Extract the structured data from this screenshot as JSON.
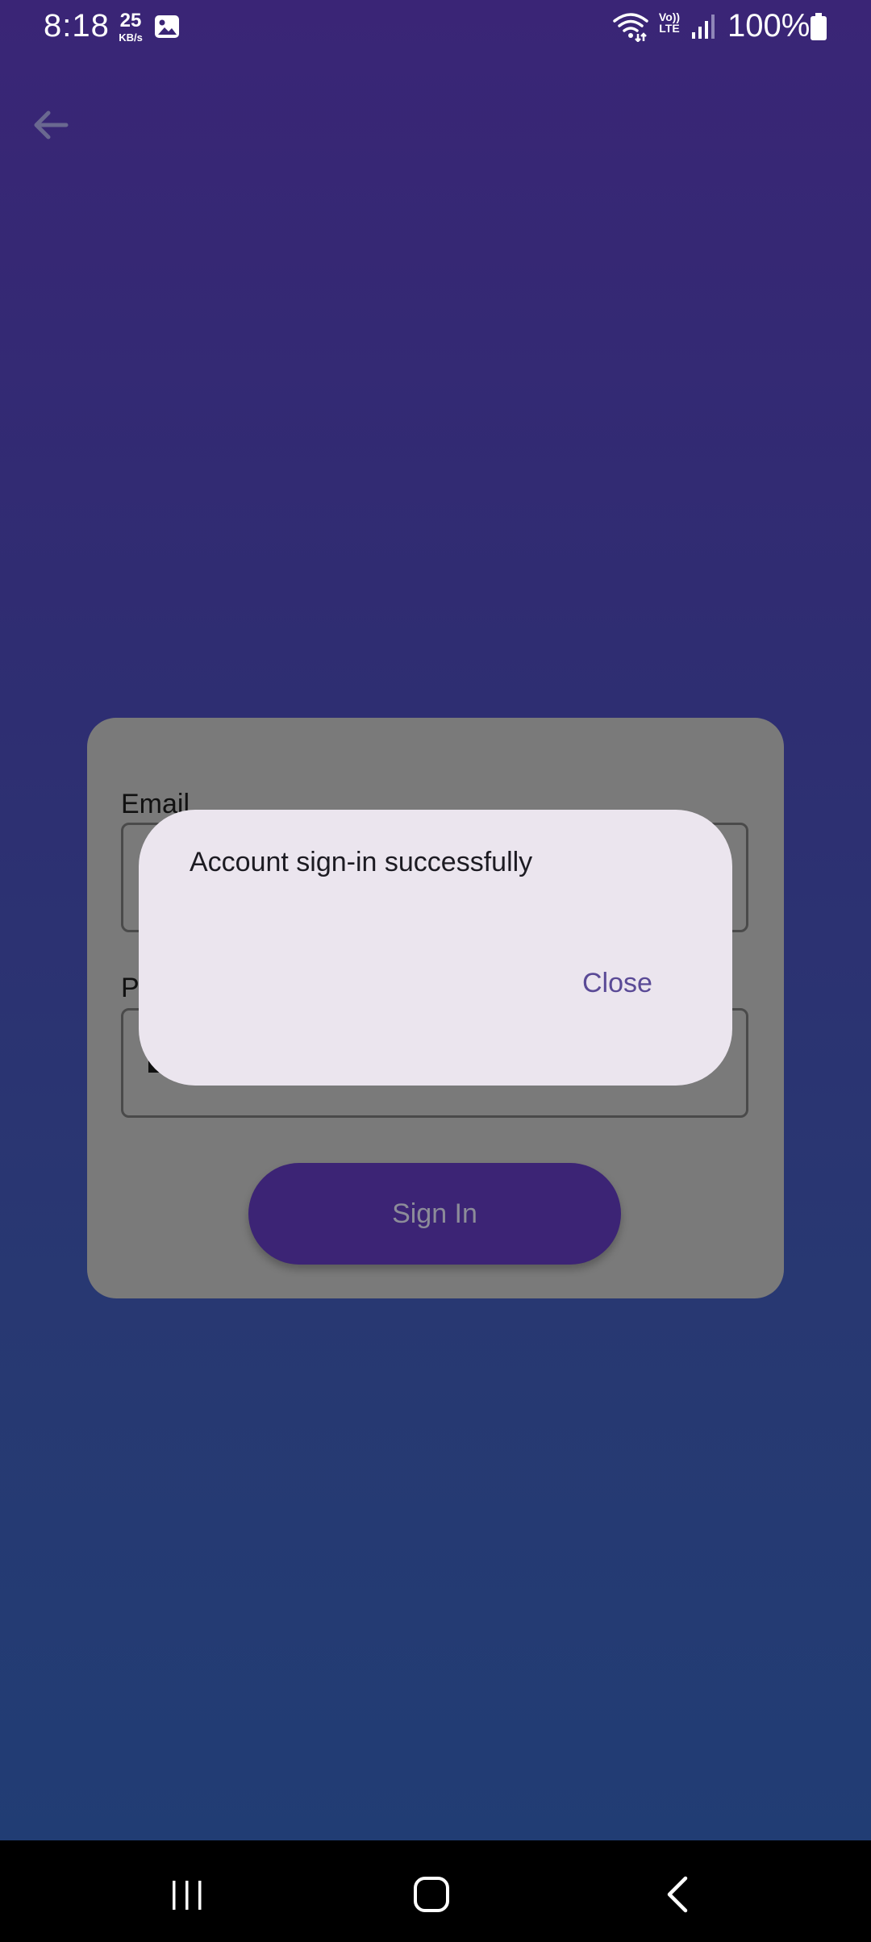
{
  "status_bar": {
    "time": "8:18",
    "net_speed_value": "25",
    "net_speed_unit": "KB/s",
    "volte_top": "Vo))",
    "volte_bottom": "LTE",
    "battery_percent": "100%",
    "icons": [
      "gallery-icon",
      "wifi-icon",
      "signal-icon",
      "battery-icon"
    ]
  },
  "toolbar": {
    "back_icon": "arrow-left-icon"
  },
  "form": {
    "email_label": "Email",
    "password_label": "Pa",
    "email_value": "",
    "password_value": "",
    "sign_in_label": "Sign In"
  },
  "dialog": {
    "message": "Account sign-in successfully",
    "close_label": "Close"
  },
  "nav_bar": {
    "icons": [
      "recents-icon",
      "home-icon",
      "back-icon"
    ]
  },
  "colors": {
    "accent": "#3c2475",
    "dialog_button": "#5a4a96",
    "dialog_bg": "#ebe5ee"
  }
}
